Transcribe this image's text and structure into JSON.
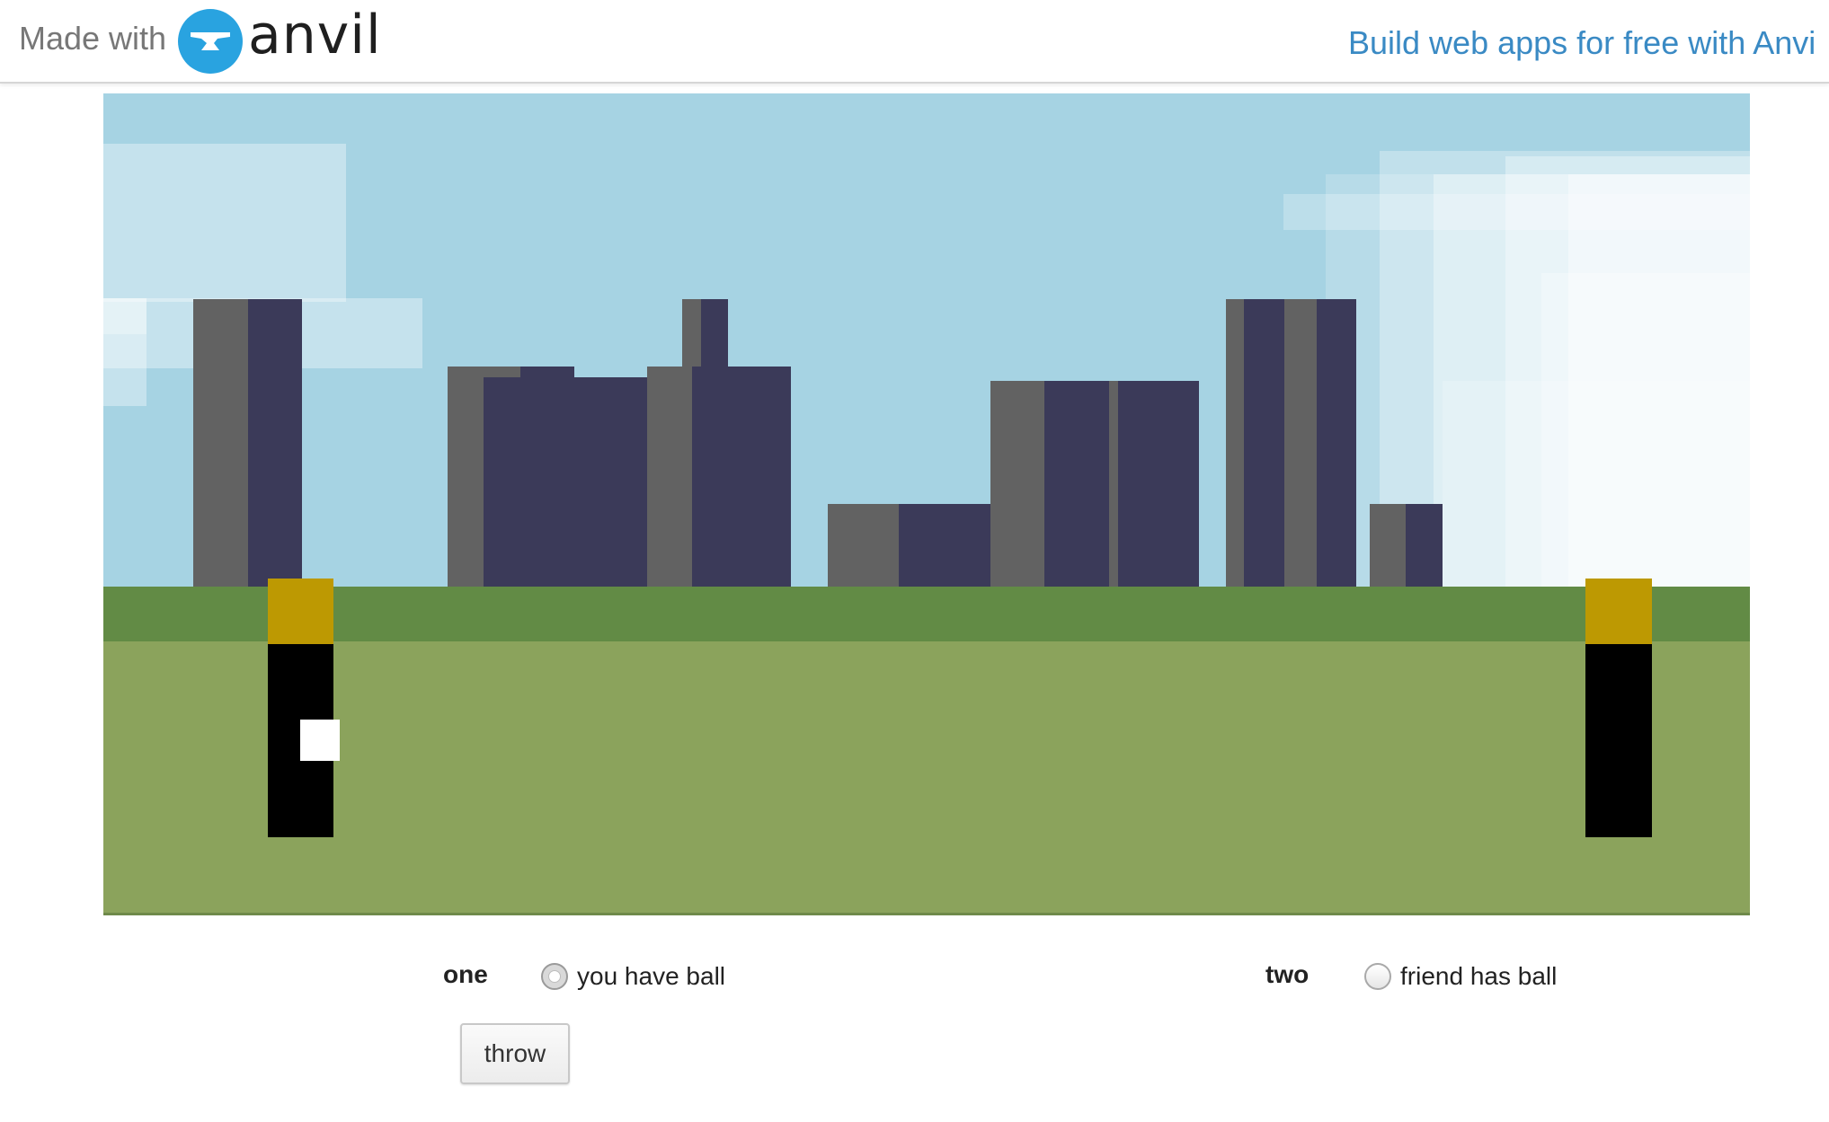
{
  "banner": {
    "made_with": "Made with",
    "logo_text": "anvil",
    "promo_link": "Build web apps for free with Anvi"
  },
  "colors": {
    "sky": "#a6d3e3",
    "cloud": "#ffffff",
    "building_gray": "#626262",
    "building_navy": "#3b3a59",
    "grass_dark": "#628b45",
    "grass_light": "#8ba35c",
    "player_head": "#bd9902",
    "player_body": "#000000",
    "ball": "#ffffff",
    "anvil_blue": "#29a3e0",
    "link_blue": "#3a8ac4"
  },
  "game": {
    "player_one_has_ball": true,
    "player_two_has_ball": false
  },
  "controls": {
    "player_one": {
      "label": "one",
      "radio_text": "you have ball",
      "checked": true
    },
    "player_two": {
      "label": "two",
      "radio_text": "friend has ball",
      "checked": false
    },
    "throw_label": "throw"
  }
}
